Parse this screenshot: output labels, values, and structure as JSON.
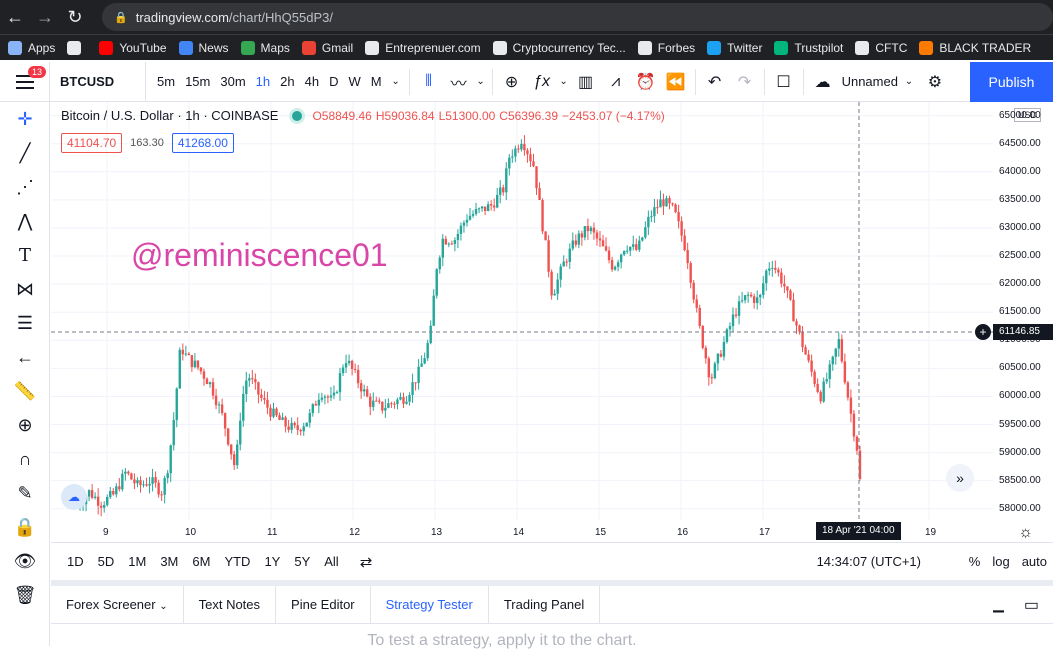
{
  "browser": {
    "url_host": "tradingview.com",
    "url_path": "/chart/HhQ55dP3/",
    "bookmarks": [
      {
        "label": "Apps",
        "icon": "apps-grid-icon",
        "color": "#8ab4f8"
      },
      {
        "label": "",
        "icon": "globe-icon",
        "color": "#e8eaed"
      },
      {
        "label": "YouTube",
        "icon": "youtube-icon",
        "color": "#ff0000"
      },
      {
        "label": "News",
        "icon": "news-icon",
        "color": "#4285f4"
      },
      {
        "label": "Maps",
        "icon": "maps-icon",
        "color": "#34a853"
      },
      {
        "label": "Gmail",
        "icon": "gmail-icon",
        "color": "#ea4335"
      },
      {
        "label": "Entreprenuer.com",
        "icon": "entrepreneur-icon",
        "color": "#e8eaed"
      },
      {
        "label": "Cryptocurrency Tec...",
        "icon": "globe-icon",
        "color": "#e8eaed"
      },
      {
        "label": "Forbes",
        "icon": "globe-icon",
        "color": "#e8eaed"
      },
      {
        "label": "Twitter",
        "icon": "twitter-icon",
        "color": "#1da1f2"
      },
      {
        "label": "Trustpilot",
        "icon": "trustpilot-icon",
        "color": "#00b67a"
      },
      {
        "label": "CFTC",
        "icon": "cftc-icon",
        "color": "#e8eaed"
      },
      {
        "label": "BLACK TRADER",
        "icon": "black-trader-icon",
        "color": "#ff7a00"
      }
    ]
  },
  "toolbar": {
    "menu_badge": "13",
    "symbol": "BTCUSD",
    "timeframes": [
      "5m",
      "15m",
      "30m",
      "1h",
      "2h",
      "4h",
      "D",
      "W",
      "M"
    ],
    "active_timeframe": "1h",
    "layout_name": "Unnamed",
    "publish_label": "Publish"
  },
  "legend": {
    "title": "Bitcoin / U.S. Dollar · 1h · COINBASE",
    "open": "O58849.46",
    "high": "H59036.84",
    "low": "L51300.00",
    "close": "C56396.39",
    "change": "−2453.07 (−4.17%)",
    "sell_price": "41104.70",
    "spread": "163.30",
    "buy_price": "41268.00"
  },
  "watermark": "@reminiscence01",
  "axis": {
    "currency": "USD",
    "y_ticks": [
      "65000.00",
      "64500.00",
      "64000.00",
      "63500.00",
      "63000.00",
      "62500.00",
      "62000.00",
      "61500.00",
      "61000.00",
      "60500.00",
      "60000.00",
      "59500.00",
      "59000.00",
      "58500.00",
      "58000.00"
    ],
    "x_ticks": [
      "9",
      "10",
      "11",
      "12",
      "13",
      "14",
      "15",
      "16",
      "17",
      "19"
    ],
    "crosshair_price": "61146.85",
    "crosshair_date": "18 Apr '21   04:00"
  },
  "chart_data": {
    "type": "candlestick",
    "ylim": [
      57800,
      65100
    ],
    "up_color": "#26a69a",
    "down_color": "#ef5350",
    "close_path": [
      {
        "x": 0,
        "y": 58050
      },
      {
        "x": 4,
        "y": 58300
      },
      {
        "x": 8,
        "y": 58100
      },
      {
        "x": 12,
        "y": 58250
      },
      {
        "x": 16,
        "y": 58650
      },
      {
        "x": 20,
        "y": 58400
      },
      {
        "x": 24,
        "y": 58500
      },
      {
        "x": 28,
        "y": 58300
      },
      {
        "x": 30,
        "y": 58800
      },
      {
        "x": 32,
        "y": 59700
      },
      {
        "x": 34,
        "y": 60900
      },
      {
        "x": 36,
        "y": 60700
      },
      {
        "x": 40,
        "y": 60500
      },
      {
        "x": 44,
        "y": 60200
      },
      {
        "x": 48,
        "y": 59600
      },
      {
        "x": 52,
        "y": 58700
      },
      {
        "x": 54,
        "y": 59900
      },
      {
        "x": 56,
        "y": 60400
      },
      {
        "x": 60,
        "y": 60000
      },
      {
        "x": 64,
        "y": 59700
      },
      {
        "x": 68,
        "y": 59500
      },
      {
        "x": 72,
        "y": 59400
      },
      {
        "x": 76,
        "y": 59600
      },
      {
        "x": 80,
        "y": 60100
      },
      {
        "x": 84,
        "y": 59900
      },
      {
        "x": 88,
        "y": 60700
      },
      {
        "x": 92,
        "y": 60300
      },
      {
        "x": 96,
        "y": 59900
      },
      {
        "x": 100,
        "y": 59800
      },
      {
        "x": 104,
        "y": 59900
      },
      {
        "x": 108,
        "y": 60000
      },
      {
        "x": 112,
        "y": 60400
      },
      {
        "x": 114,
        "y": 60700
      },
      {
        "x": 116,
        "y": 61100
      },
      {
        "x": 118,
        "y": 62300
      },
      {
        "x": 120,
        "y": 62800
      },
      {
        "x": 124,
        "y": 62800
      },
      {
        "x": 128,
        "y": 63200
      },
      {
        "x": 132,
        "y": 63300
      },
      {
        "x": 136,
        "y": 63400
      },
      {
        "x": 140,
        "y": 63700
      },
      {
        "x": 142,
        "y": 64300
      },
      {
        "x": 144,
        "y": 64400
      },
      {
        "x": 146,
        "y": 64600
      },
      {
        "x": 150,
        "y": 64100
      },
      {
        "x": 154,
        "y": 62600
      },
      {
        "x": 156,
        "y": 61800
      },
      {
        "x": 160,
        "y": 62400
      },
      {
        "x": 164,
        "y": 62800
      },
      {
        "x": 168,
        "y": 63000
      },
      {
        "x": 172,
        "y": 62700
      },
      {
        "x": 176,
        "y": 62300
      },
      {
        "x": 180,
        "y": 62700
      },
      {
        "x": 184,
        "y": 62600
      },
      {
        "x": 188,
        "y": 63200
      },
      {
        "x": 192,
        "y": 63500
      },
      {
        "x": 196,
        "y": 63300
      },
      {
        "x": 200,
        "y": 62600
      },
      {
        "x": 204,
        "y": 61300
      },
      {
        "x": 208,
        "y": 60300
      },
      {
        "x": 212,
        "y": 60900
      },
      {
        "x": 216,
        "y": 61500
      },
      {
        "x": 220,
        "y": 61800
      },
      {
        "x": 224,
        "y": 61700
      },
      {
        "x": 226,
        "y": 62200
      },
      {
        "x": 228,
        "y": 62400
      },
      {
        "x": 232,
        "y": 62000
      },
      {
        "x": 236,
        "y": 61300
      },
      {
        "x": 240,
        "y": 60600
      },
      {
        "x": 244,
        "y": 60000
      },
      {
        "x": 248,
        "y": 60600
      },
      {
        "x": 250,
        "y": 61000
      },
      {
        "x": 254,
        "y": 59700
      },
      {
        "x": 256,
        "y": 59100
      },
      {
        "x": 258,
        "y": 57900
      }
    ]
  },
  "range_bar": {
    "ranges": [
      "1D",
      "5D",
      "1M",
      "3M",
      "6M",
      "YTD",
      "1Y",
      "5Y",
      "All"
    ],
    "clock": "14:34:07 (UTC+1)",
    "scale_percent": "%",
    "scale_log": "log",
    "scale_auto": "auto"
  },
  "panel": {
    "tabs": [
      "Forex Screener",
      "Text Notes",
      "Pine Editor",
      "Strategy Tester",
      "Trading Panel"
    ],
    "active_tab": "Strategy Tester",
    "message": "To test a strategy, apply it to the chart."
  }
}
